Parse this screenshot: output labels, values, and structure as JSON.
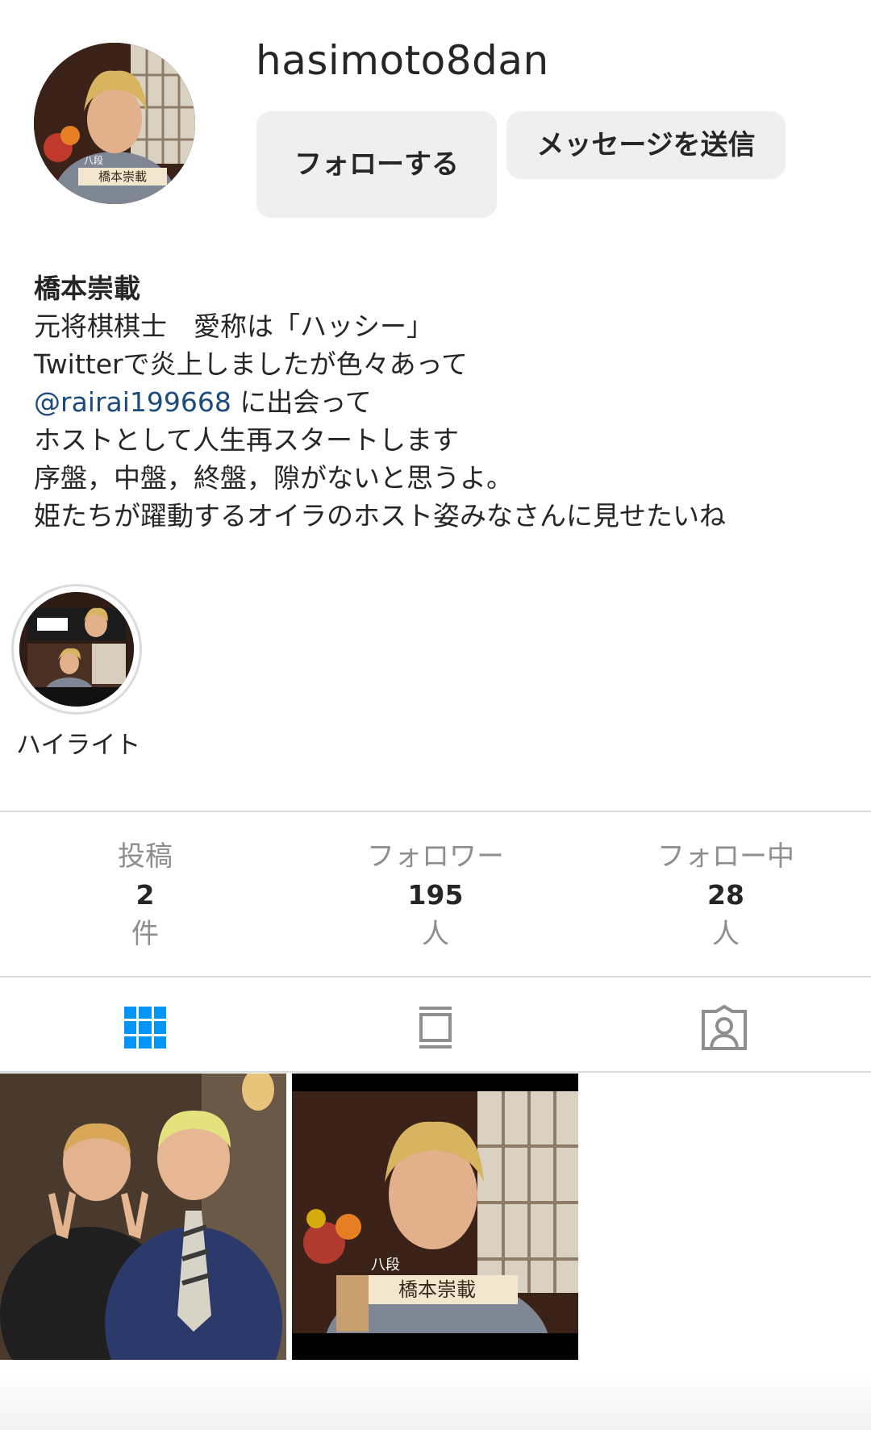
{
  "profile": {
    "username": "hasimoto8dan",
    "follow_label": "フォローする",
    "message_label": "メッセージを送信",
    "avatar_caption_rank": "八段",
    "avatar_caption_name": "橋本崇載"
  },
  "bio": {
    "name": "橋本崇載",
    "line1": "元将棋棋士　愛称は「ハッシー」",
    "line2": "Twitterで炎上しましたが色々あって",
    "mention": "@rairai199668",
    "line3_suffix": " に出会って",
    "line4": "ホストとして人生再スタートします",
    "line5": "序盤，中盤，終盤，隙がないと思うよ。",
    "line6": "姫たちが躍動するオイラのホスト姿みなさんに見せたいね"
  },
  "highlight": {
    "label": "ハイライト"
  },
  "stats": {
    "posts_label": "投稿",
    "posts_value": "2",
    "posts_unit": "件",
    "followers_label": "フォロワー",
    "followers_value": "195",
    "followers_unit": "人",
    "following_label": "フォロー中",
    "following_value": "28",
    "following_unit": "人"
  },
  "tabs": [
    {
      "icon": "grid-icon",
      "active": true
    },
    {
      "icon": "feed-icon",
      "active": false
    },
    {
      "icon": "tagged-icon",
      "active": false
    }
  ],
  "posts": [
    {
      "caption_rank": "",
      "caption_name": ""
    },
    {
      "caption_rank": "八段",
      "caption_name": "橋本崇載"
    }
  ],
  "colors": {
    "active_tab": "#0095f6",
    "inactive_tab": "#8e8e8e",
    "button_bg": "#efefef",
    "link": "#1c4a7a"
  }
}
